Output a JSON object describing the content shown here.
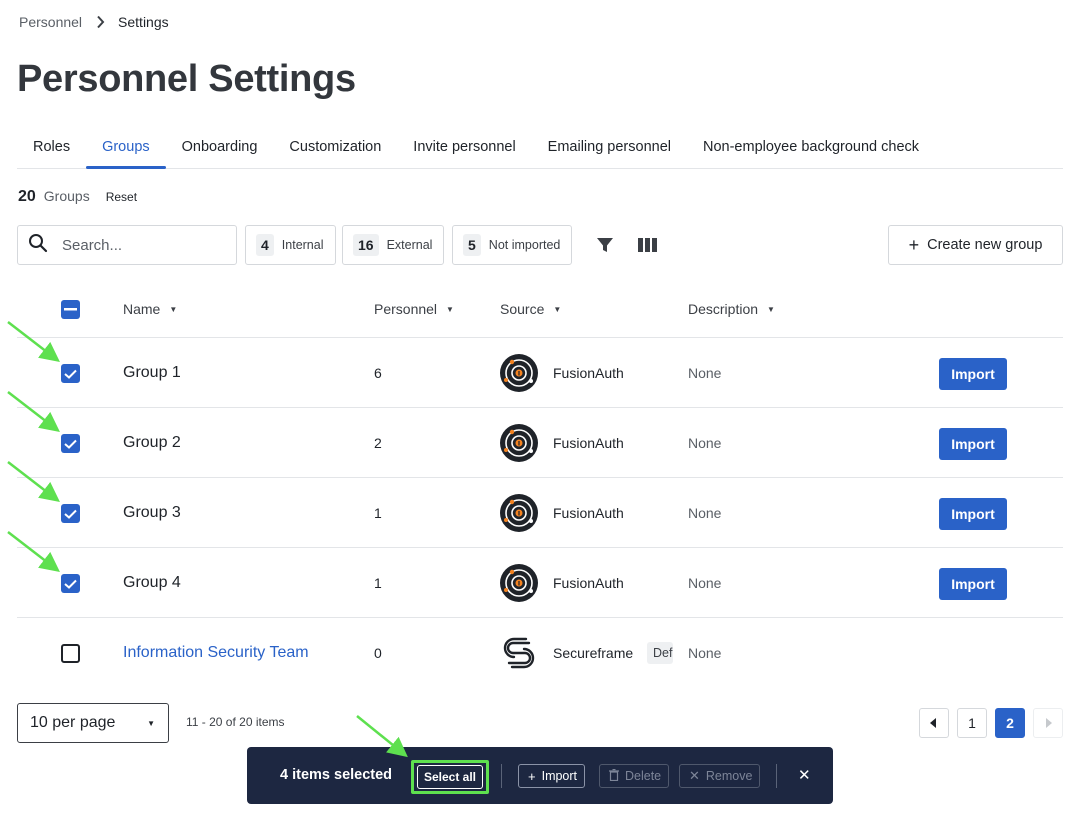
{
  "breadcrumb": {
    "parent": "Personnel",
    "current": "Settings"
  },
  "page_title": "Personnel Settings",
  "tabs": [
    {
      "label": "Roles"
    },
    {
      "label": "Groups",
      "active": true
    },
    {
      "label": "Onboarding"
    },
    {
      "label": "Customization"
    },
    {
      "label": "Invite personnel"
    },
    {
      "label": "Emailing personnel"
    },
    {
      "label": "Non-employee background check"
    }
  ],
  "summary": {
    "count": "20",
    "label": "Groups",
    "reset_label": "Reset"
  },
  "search": {
    "placeholder": "Search..."
  },
  "filters": [
    {
      "count": "4",
      "label": "Internal"
    },
    {
      "count": "16",
      "label": "External"
    },
    {
      "count": "5",
      "label": "Not imported"
    }
  ],
  "toolbar": {
    "filter_icon": "filter-icon",
    "columns_icon": "columns-icon",
    "create_label": "Create new group"
  },
  "table": {
    "headers": {
      "name": "Name",
      "personnel": "Personnel",
      "source": "Source",
      "description": "Description"
    },
    "rows": [
      {
        "name": "Group 1",
        "personnel": "6",
        "source": "FusionAuth",
        "description": "None",
        "action": "Import",
        "checked": true
      },
      {
        "name": "Group 2",
        "personnel": "2",
        "source": "FusionAuth",
        "description": "None",
        "action": "Import",
        "checked": true
      },
      {
        "name": "Group 3",
        "personnel": "1",
        "source": "FusionAuth",
        "description": "None",
        "action": "Import",
        "checked": true
      },
      {
        "name": "Group 4",
        "personnel": "1",
        "source": "FusionAuth",
        "description": "None",
        "action": "Import",
        "checked": true
      },
      {
        "name": "Information Security Team",
        "personnel": "0",
        "source": "Secureframe",
        "tag": "Default",
        "description": "None",
        "checked": false
      }
    ]
  },
  "pagination": {
    "per_page": "10 per page",
    "range": "11 - 20 of 20 items",
    "pages": [
      "1",
      "2"
    ],
    "current_page": "2"
  },
  "action_bar": {
    "selected_text": "4 items selected",
    "select_all": "Select all",
    "import": "Import",
    "delete": "Delete",
    "remove": "Remove"
  },
  "colors": {
    "accent": "#2a62c8",
    "action_bar_bg": "#1d2741",
    "annotation": "#5ee04f"
  }
}
